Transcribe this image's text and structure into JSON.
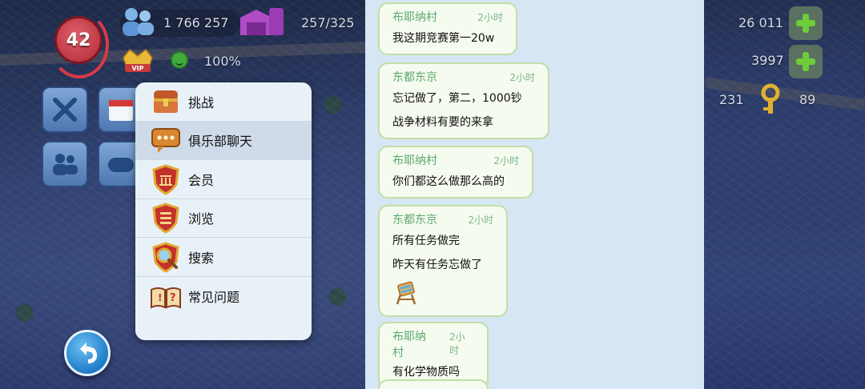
{
  "hud": {
    "level": "42",
    "population": "1 766 257",
    "buildings": "257/325",
    "happiness": "100%",
    "simoleons": "26 011",
    "simcash": "3997",
    "golden_keys": "231",
    "platinum_keys": "89",
    "vip_label": "VIP"
  },
  "menu": {
    "items": [
      {
        "label": "挑战",
        "icon": "treasure-chest-icon"
      },
      {
        "label": "俱乐部聊天",
        "icon": "chat-bubble-icon"
      },
      {
        "label": "会员",
        "icon": "member-shield-icon"
      },
      {
        "label": "浏览",
        "icon": "list-shield-icon"
      },
      {
        "label": "搜索",
        "icon": "magnifier-icon"
      },
      {
        "label": "常见问题",
        "icon": "faq-book-icon"
      }
    ],
    "active_index": 1
  },
  "chat": {
    "messages": [
      {
        "name": "布耶纳村",
        "time": "2小时",
        "lines": [
          "我这期竞赛第一20w"
        ]
      },
      {
        "name": "东都东京",
        "time": "2小时",
        "lines": [
          "忘记做了，第二，1000钞",
          "战争材料有要的来拿"
        ]
      },
      {
        "name": "布耶纳村",
        "time": "2小时",
        "lines": [
          "你们都这么做那么高的"
        ]
      },
      {
        "name": "东都东京",
        "time": "2小时",
        "lines": [
          "所有任务做完",
          "昨天有任务忘做了"
        ],
        "sticker": "chair-icon"
      },
      {
        "name": "布耶纳村",
        "time": "2小时",
        "lines": [
          "有化学物质吗"
        ]
      }
    ]
  }
}
